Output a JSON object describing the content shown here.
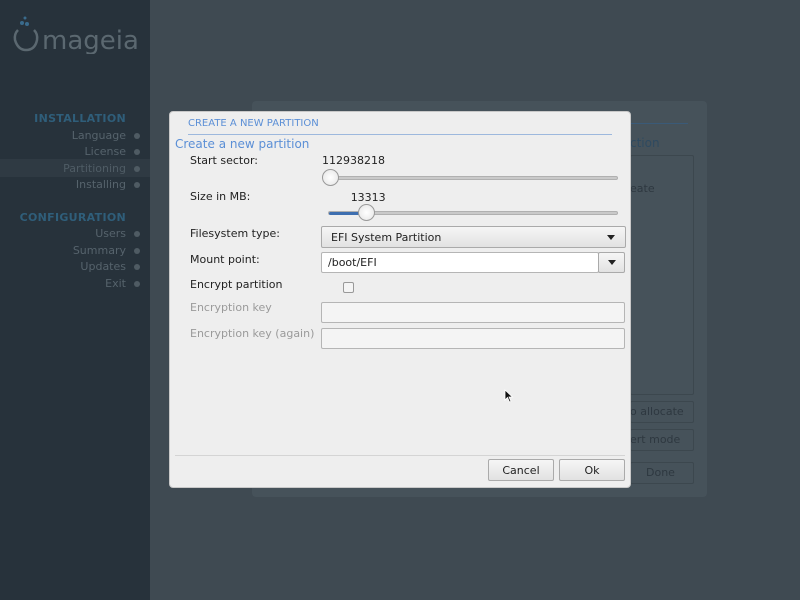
{
  "sidebar": {
    "logo_text": "mageia",
    "sections": [
      {
        "title": "INSTALLATION",
        "items": [
          "Language",
          "License",
          "Partitioning",
          "Installing"
        ]
      },
      {
        "title": "CONFIGURATION",
        "items": [
          "Users",
          "Summary",
          "Updates",
          "Exit"
        ]
      }
    ],
    "active_item": "Partitioning"
  },
  "background": {
    "heading_fragment": "ction",
    "column_fragment": "eate",
    "auto_allocate_fragment": "o allocate",
    "expert_mode_fragment": "ert mode",
    "done_label": "Done"
  },
  "dialog": {
    "title": "CREATE A NEW PARTITION",
    "subtitle": "Create a new partition",
    "start_sector": {
      "label": "Start sector:",
      "value": "112938218",
      "fraction": 0
    },
    "size": {
      "label": "Size in MB:",
      "value": "13313",
      "fraction": 0.13
    },
    "filesystem": {
      "label": "Filesystem type:",
      "value": "EFI System Partition"
    },
    "mount_point": {
      "label": "Mount point:",
      "value": "/boot/EFI"
    },
    "encrypt": {
      "label": "Encrypt partition",
      "checked": false
    },
    "encryption_key": {
      "label": "Encryption key",
      "value": ""
    },
    "encryption_key_again": {
      "label": "Encryption key (again)",
      "value": ""
    },
    "cancel_label": "Cancel",
    "ok_label": "Ok"
  },
  "colors": {
    "accent": "#5b8fd6",
    "sidebar_bg": "#27323b",
    "section_title": "#2f5e7a"
  }
}
